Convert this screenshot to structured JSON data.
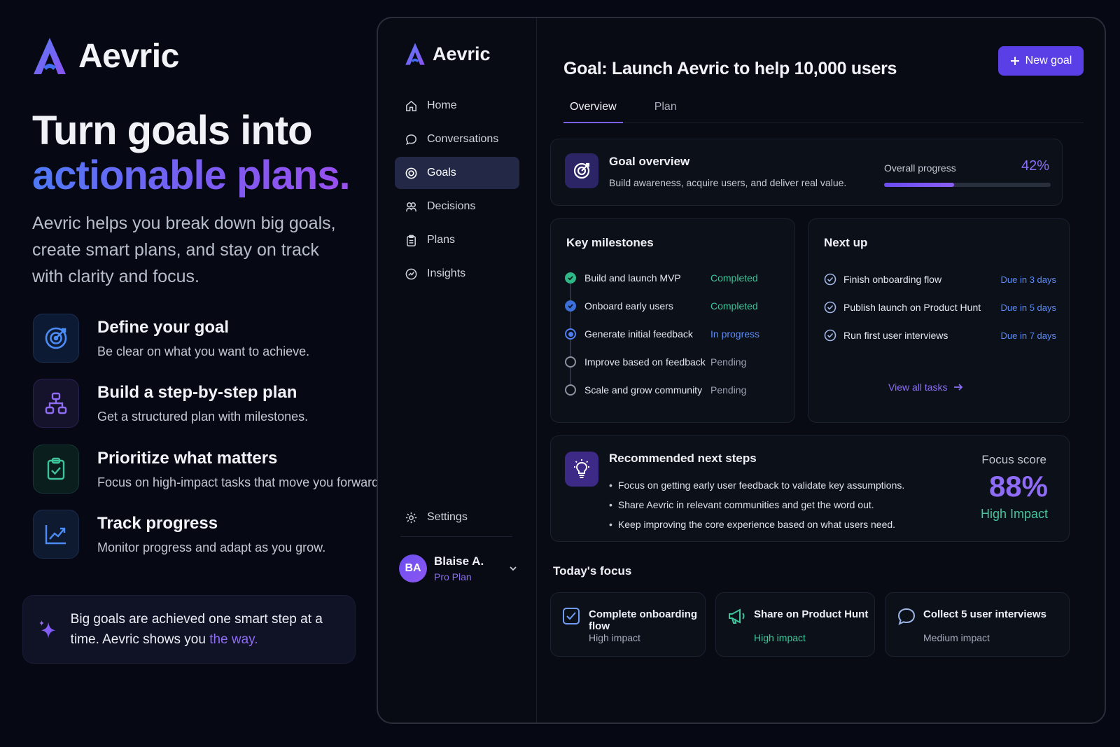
{
  "brand": {
    "name": "Aevric"
  },
  "hero": {
    "headline_line1": "Turn goals into",
    "headline_line2": "actionable plans.",
    "intro": "Aevric helps you break down big goals, create smart plans, and stay on track with clarity and focus."
  },
  "features": [
    {
      "icon": "target-icon",
      "title": "Define your goal",
      "desc": "Be clear on what you want to achieve."
    },
    {
      "icon": "hierarchy-icon",
      "title": "Build a step-by-step plan",
      "desc": "Get a structured plan with milestones."
    },
    {
      "icon": "clipboard-check-icon",
      "title": "Prioritize what matters",
      "desc": "Focus on high-impact tasks that move you forward."
    },
    {
      "icon": "chart-trend-icon",
      "title": "Track progress",
      "desc": "Monitor progress and adapt as you grow."
    }
  ],
  "quote": {
    "text_main": "Big goals are achieved one smart step at a time. Aevric shows you ",
    "highlight": "the way."
  },
  "app": {
    "brand": "Aevric",
    "nav": [
      {
        "label": "Home",
        "icon": "home-icon",
        "active": false
      },
      {
        "label": "Conversations",
        "icon": "chat-icon",
        "active": false
      },
      {
        "label": "Goals",
        "icon": "target-icon",
        "active": true
      },
      {
        "label": "Decisions",
        "icon": "decisions-icon",
        "active": false
      },
      {
        "label": "Plans",
        "icon": "clipboard-icon",
        "active": false
      },
      {
        "label": "Insights",
        "icon": "insights-icon",
        "active": false
      }
    ],
    "settings_label": "Settings",
    "user": {
      "initials": "BA",
      "name": "Blaise A.",
      "plan": "Pro Plan"
    },
    "goal_title": "Goal: Launch Aevric to help 10,000 users",
    "new_goal_label": "New goal",
    "tabs": [
      {
        "label": "Overview",
        "active": true
      },
      {
        "label": "Plan",
        "active": false
      }
    ],
    "overview": {
      "title": "Goal overview",
      "desc": "Build awareness, acquire users, and deliver real value.",
      "progress_label": "Overall progress",
      "progress_text": "42%",
      "progress_value": 0.42
    },
    "milestones": {
      "title": "Key milestones",
      "items": [
        {
          "name": "Build and launch MVP",
          "status": "Completed",
          "state": "completed"
        },
        {
          "name": "Onboard early users",
          "status": "Completed",
          "state": "completed"
        },
        {
          "name": "Generate initial feedback",
          "status": "In progress",
          "state": "progress"
        },
        {
          "name": "Improve based on feedback",
          "status": "Pending",
          "state": "pending"
        },
        {
          "name": "Scale and grow community",
          "status": "Pending",
          "state": "pending"
        }
      ]
    },
    "next_up": {
      "title": "Next up",
      "items": [
        {
          "task": "Finish onboarding flow",
          "due": "Due in 3 days"
        },
        {
          "task": "Publish launch on Product Hunt",
          "due": "Due in 5 days"
        },
        {
          "task": "Run first user interviews",
          "due": "Due in 7 days"
        }
      ],
      "view_all": "View all tasks"
    },
    "recommended": {
      "title": "Recommended next steps",
      "items": [
        "Focus on getting early user feedback to validate key assumptions.",
        "Share Aevric in relevant communities and get the word out.",
        "Keep improving the core experience based on what users need."
      ],
      "focus_label": "Focus score",
      "focus_value": "88%",
      "impact": "High Impact"
    },
    "today": {
      "title": "Today's focus",
      "items": [
        {
          "title": "Complete onboarding flow",
          "impact": "High impact",
          "icon": "checkbox-icon"
        },
        {
          "title": "Share on Product Hunt",
          "impact": "High impact",
          "icon": "megaphone-icon"
        },
        {
          "title": "Collect 5 user interviews",
          "impact": "Medium impact",
          "icon": "chat-bubble-icon"
        }
      ]
    }
  },
  "colors": {
    "accent": "#5b3fe6",
    "accent_text": "#8a6ef6",
    "success": "#44c29a",
    "info": "#5c8cf5",
    "background": "#060913"
  }
}
